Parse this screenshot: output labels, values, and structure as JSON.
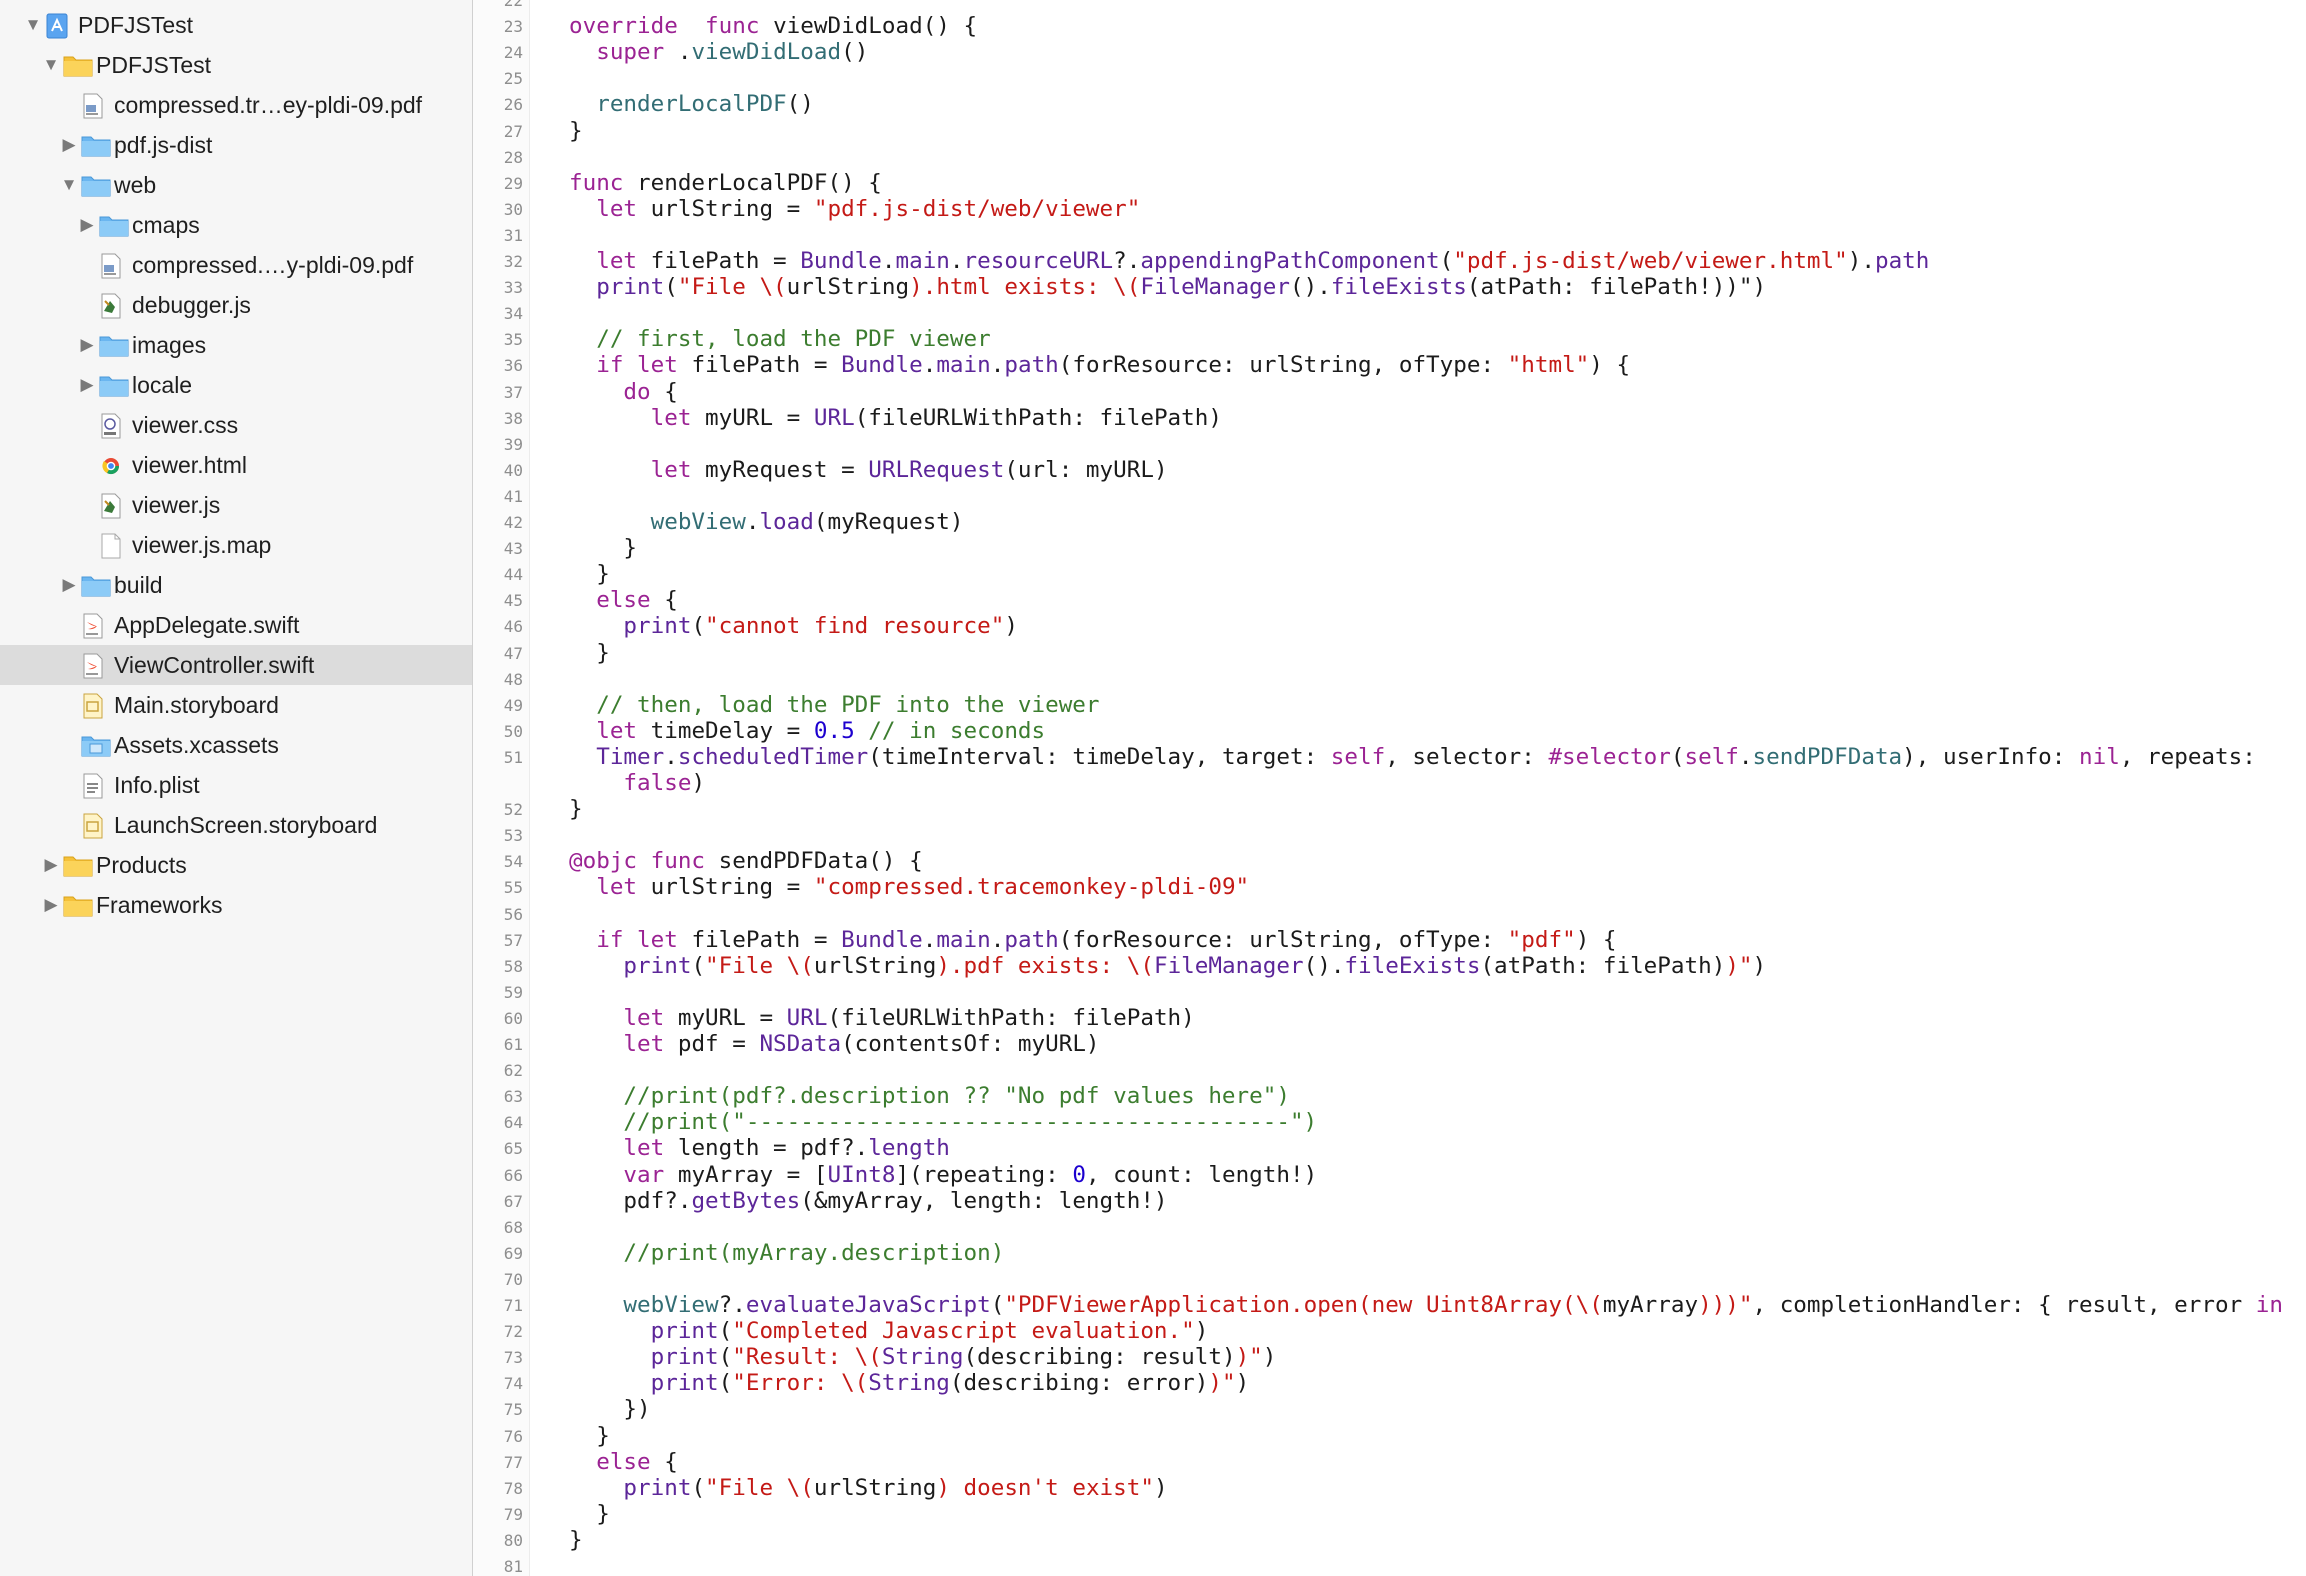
{
  "navigator": {
    "items": [
      {
        "id": "project",
        "label": "PDFJSTest",
        "depth": 0,
        "type": "project",
        "disclosure": "open"
      },
      {
        "id": "group-pdfjstest",
        "label": "PDFJSTest",
        "depth": 1,
        "type": "folder-yellow",
        "disclosure": "open"
      },
      {
        "id": "file-compressed-pdf",
        "label": "compressed.tr…ey-pldi-09.pdf",
        "depth": 2,
        "type": "pdf",
        "disclosure": "none"
      },
      {
        "id": "folder-pdfjs-dist",
        "label": "pdf.js-dist",
        "depth": 2,
        "type": "folder-blue",
        "disclosure": "closed"
      },
      {
        "id": "folder-web",
        "label": "web",
        "depth": 2,
        "type": "folder-blue",
        "disclosure": "open"
      },
      {
        "id": "folder-cmaps",
        "label": "cmaps",
        "depth": 3,
        "type": "folder-blue",
        "disclosure": "closed"
      },
      {
        "id": "file-web-compressed-pdf",
        "label": "compressed.…y-pldi-09.pdf",
        "depth": 3,
        "type": "pdf",
        "disclosure": "none"
      },
      {
        "id": "file-debugger-js",
        "label": "debugger.js",
        "depth": 3,
        "type": "js",
        "disclosure": "none"
      },
      {
        "id": "folder-images",
        "label": "images",
        "depth": 3,
        "type": "folder-blue",
        "disclosure": "closed"
      },
      {
        "id": "folder-locale",
        "label": "locale",
        "depth": 3,
        "type": "folder-blue",
        "disclosure": "closed"
      },
      {
        "id": "file-viewer-css",
        "label": "viewer.css",
        "depth": 3,
        "type": "css",
        "disclosure": "none"
      },
      {
        "id": "file-viewer-html",
        "label": "viewer.html",
        "depth": 3,
        "type": "html",
        "disclosure": "none"
      },
      {
        "id": "file-viewer-js",
        "label": "viewer.js",
        "depth": 3,
        "type": "js",
        "disclosure": "none"
      },
      {
        "id": "file-viewer-js-map",
        "label": "viewer.js.map",
        "depth": 3,
        "type": "blank",
        "disclosure": "none"
      },
      {
        "id": "folder-build",
        "label": "build",
        "depth": 2,
        "type": "folder-blue",
        "disclosure": "closed"
      },
      {
        "id": "file-appdelegate",
        "label": "AppDelegate.swift",
        "depth": 2,
        "type": "swift",
        "disclosure": "none"
      },
      {
        "id": "file-viewcontroller",
        "label": "ViewController.swift",
        "depth": 2,
        "type": "swift",
        "disclosure": "none",
        "selected": true
      },
      {
        "id": "file-main-storyboard",
        "label": "Main.storyboard",
        "depth": 2,
        "type": "storyboard",
        "disclosure": "none"
      },
      {
        "id": "file-assets",
        "label": "Assets.xcassets",
        "depth": 2,
        "type": "assets",
        "disclosure": "none"
      },
      {
        "id": "file-info-plist",
        "label": "Info.plist",
        "depth": 2,
        "type": "plist",
        "disclosure": "none"
      },
      {
        "id": "file-launchscreen",
        "label": "LaunchScreen.storyboard",
        "depth": 2,
        "type": "storyboard",
        "disclosure": "none"
      },
      {
        "id": "group-products",
        "label": "Products",
        "depth": 1,
        "type": "folder-yellow",
        "disclosure": "closed"
      },
      {
        "id": "group-frameworks",
        "label": "Frameworks",
        "depth": 1,
        "type": "folder-yellow",
        "disclosure": "closed"
      }
    ]
  },
  "editor": {
    "first_line_number": 22,
    "line_numbers": [
      "22",
      "23",
      "24",
      "25",
      "26",
      "27",
      "28",
      "29",
      "30",
      "31",
      "32",
      "33",
      "34",
      "35",
      "36",
      "37",
      "38",
      "39",
      "40",
      "41",
      "42",
      "43",
      "44",
      "45",
      "46",
      "47",
      "48",
      "49",
      "50",
      "51",
      "",
      "52",
      "53",
      "54",
      "55",
      "56",
      "57",
      "58",
      "59",
      "60",
      "61",
      "62",
      "63",
      "64",
      "65",
      "66",
      "67",
      "68",
      "69",
      "70",
      "71",
      "72",
      "73",
      "74",
      "75",
      "76",
      "77",
      "78",
      "79",
      "80",
      "81"
    ],
    "lines": [
      [],
      [
        [
          "k",
          "override"
        ],
        [
          "",
          "  "
        ],
        [
          "k",
          "func"
        ],
        [
          "",
          " viewDidLoad() {"
        ]
      ],
      [
        [
          "",
          "  "
        ],
        [
          "k",
          "super"
        ],
        [
          "",
          " ."
        ],
        [
          "m",
          "viewDidLoad"
        ],
        [
          "",
          "()"
        ]
      ],
      [],
      [
        [
          "",
          "  "
        ],
        [
          "m",
          "renderLocalPDF"
        ],
        [
          "",
          "()"
        ]
      ],
      [
        [
          "",
          "}"
        ]
      ],
      [],
      [
        [
          "k",
          "func"
        ],
        [
          "",
          " renderLocalPDF() {"
        ]
      ],
      [
        [
          "",
          "  "
        ],
        [
          "k",
          "let"
        ],
        [
          "",
          " urlString = "
        ],
        [
          "s",
          "\"pdf.js-dist/web/viewer\""
        ]
      ],
      [],
      [
        [
          "",
          "  "
        ],
        [
          "k",
          "let"
        ],
        [
          "",
          " filePath = "
        ],
        [
          "t",
          "Bundle"
        ],
        [
          "",
          "."
        ],
        [
          "t",
          "main"
        ],
        [
          "",
          "."
        ],
        [
          "t",
          "resourceURL"
        ],
        [
          "",
          "?."
        ],
        [
          "t",
          "appendingPathComponent"
        ],
        [
          "",
          "("
        ],
        [
          "s",
          "\"pdf.js-dist/web/viewer.html\""
        ],
        [
          "",
          ")."
        ],
        [
          "t",
          "path"
        ]
      ],
      [
        [
          "",
          "  "
        ],
        [
          "t",
          "print"
        ],
        [
          "",
          "("
        ],
        [
          "s",
          "\"File \\("
        ],
        [
          "",
          "urlString"
        ],
        [
          "s",
          ").html exists: \\("
        ],
        [
          "t",
          "FileManager"
        ],
        [
          "",
          "()."
        ],
        [
          "t",
          "fileExists"
        ],
        [
          "",
          "(atPath: filePath!))\""
        ],
        [
          "",
          ")"
        ]
      ],
      [],
      [
        [
          "",
          "  "
        ],
        [
          "c",
          "// first, load the PDF viewer"
        ]
      ],
      [
        [
          "",
          "  "
        ],
        [
          "k",
          "if"
        ],
        [
          "",
          ""
        ],
        [
          "k",
          " let"
        ],
        [
          "",
          " filePath = "
        ],
        [
          "t",
          "Bundle"
        ],
        [
          "",
          "."
        ],
        [
          "t",
          "main"
        ],
        [
          "",
          "."
        ],
        [
          "t",
          "path"
        ],
        [
          "",
          "(forResource: urlString, ofType: "
        ],
        [
          "s",
          "\"html\""
        ],
        [
          "",
          ") {"
        ]
      ],
      [
        [
          "",
          "    "
        ],
        [
          "k",
          "do"
        ],
        [
          "",
          " {"
        ]
      ],
      [
        [
          "",
          "      "
        ],
        [
          "k",
          "let"
        ],
        [
          "",
          " myURL = "
        ],
        [
          "t",
          "URL"
        ],
        [
          "",
          "(fileURLWithPath: filePath)"
        ]
      ],
      [],
      [
        [
          "",
          "      "
        ],
        [
          "k",
          "let"
        ],
        [
          "",
          " myRequest = "
        ],
        [
          "t",
          "URLRequest"
        ],
        [
          "",
          "(url: myURL)"
        ]
      ],
      [],
      [
        [
          "",
          "      "
        ],
        [
          "m",
          "webView"
        ],
        [
          "",
          "."
        ],
        [
          "t",
          "load"
        ],
        [
          "",
          "(myRequest)"
        ]
      ],
      [
        [
          "",
          "    }"
        ]
      ],
      [
        [
          "",
          "  }"
        ]
      ],
      [
        [
          "",
          "  "
        ],
        [
          "k",
          "else"
        ],
        [
          "",
          " {"
        ]
      ],
      [
        [
          "",
          "    "
        ],
        [
          "t",
          "print"
        ],
        [
          "",
          "("
        ],
        [
          "s",
          "\"cannot find resource\""
        ],
        [
          "",
          ")"
        ]
      ],
      [
        [
          "",
          "  }"
        ]
      ],
      [],
      [
        [
          "",
          "  "
        ],
        [
          "c",
          "// then, load the PDF into the viewer"
        ]
      ],
      [
        [
          "",
          "  "
        ],
        [
          "k",
          "let"
        ],
        [
          "",
          " timeDelay = "
        ],
        [
          "n",
          "0.5"
        ],
        [
          "",
          " "
        ],
        [
          "c",
          "// in seconds"
        ]
      ],
      [
        [
          "",
          "  "
        ],
        [
          "t",
          "Timer"
        ],
        [
          "",
          "."
        ],
        [
          "t",
          "scheduledTimer"
        ],
        [
          "",
          "(timeInterval: timeDelay, target: "
        ],
        [
          "k",
          "self"
        ],
        [
          "",
          ", selector: "
        ],
        [
          "k",
          "#selector"
        ],
        [
          "",
          "("
        ],
        [
          "k",
          "self"
        ],
        [
          "",
          "."
        ],
        [
          "m",
          "sendPDFData"
        ],
        [
          "",
          "), userInfo: "
        ],
        [
          "k",
          "nil"
        ],
        [
          "",
          ", repeats:"
        ]
      ],
      [
        [
          "",
          "    "
        ],
        [
          "k",
          "false"
        ],
        [
          "",
          ")"
        ]
      ],
      [
        [
          "",
          "}"
        ]
      ],
      [],
      [
        [
          "k",
          "@objc"
        ],
        [
          "",
          " "
        ],
        [
          "k",
          "func"
        ],
        [
          "",
          " sendPDFData() {"
        ]
      ],
      [
        [
          "",
          "  "
        ],
        [
          "k",
          "let"
        ],
        [
          "",
          " urlString = "
        ],
        [
          "s",
          "\"compressed.tracemonkey-pldi-09\""
        ]
      ],
      [],
      [
        [
          "",
          "  "
        ],
        [
          "k",
          "if"
        ],
        [
          "",
          " "
        ],
        [
          "k",
          "let"
        ],
        [
          "",
          " filePath = "
        ],
        [
          "t",
          "Bundle"
        ],
        [
          "",
          "."
        ],
        [
          "t",
          "main"
        ],
        [
          "",
          "."
        ],
        [
          "t",
          "path"
        ],
        [
          "",
          "(forResource: urlString, ofType: "
        ],
        [
          "s",
          "\"pdf\""
        ],
        [
          "",
          ") {"
        ]
      ],
      [
        [
          "",
          "    "
        ],
        [
          "t",
          "print"
        ],
        [
          "",
          "("
        ],
        [
          "s",
          "\"File \\("
        ],
        [
          "",
          "urlString"
        ],
        [
          "s",
          ").pdf exists: \\("
        ],
        [
          "t",
          "FileManager"
        ],
        [
          "",
          "()."
        ],
        [
          "t",
          "fileExists"
        ],
        [
          "",
          "(atPath: filePath)"
        ],
        [
          "s",
          ")\""
        ],
        [
          "",
          ")"
        ]
      ],
      [],
      [
        [
          "",
          "    "
        ],
        [
          "k",
          "let"
        ],
        [
          "",
          " myURL = "
        ],
        [
          "t",
          "URL"
        ],
        [
          "",
          "(fileURLWithPath: filePath)"
        ]
      ],
      [
        [
          "",
          "    "
        ],
        [
          "k",
          "let"
        ],
        [
          "",
          " pdf = "
        ],
        [
          "t",
          "NSData"
        ],
        [
          "",
          "(contentsOf: myURL)"
        ]
      ],
      [],
      [
        [
          "",
          "    "
        ],
        [
          "c",
          "//print(pdf?.description ?? \"No pdf values here\")"
        ]
      ],
      [
        [
          "",
          "    "
        ],
        [
          "c",
          "//print(\"----------------------------------------\")"
        ]
      ],
      [
        [
          "",
          "    "
        ],
        [
          "k",
          "let"
        ],
        [
          "",
          " length = pdf?."
        ],
        [
          "t",
          "length"
        ]
      ],
      [
        [
          "",
          "    "
        ],
        [
          "k",
          "var"
        ],
        [
          "",
          " myArray = ["
        ],
        [
          "t",
          "UInt8"
        ],
        [
          "",
          "](repeating: "
        ],
        [
          "n",
          "0"
        ],
        [
          "",
          ", count: length!)"
        ]
      ],
      [
        [
          "",
          "    pdf?."
        ],
        [
          "t",
          "getBytes"
        ],
        [
          "",
          "(&myArray, length: length!)"
        ]
      ],
      [],
      [
        [
          "",
          "    "
        ],
        [
          "c",
          "//print(myArray.description)"
        ]
      ],
      [],
      [
        [
          "",
          "    "
        ],
        [
          "m",
          "webView"
        ],
        [
          "",
          "?."
        ],
        [
          "t",
          "evaluateJavaScript"
        ],
        [
          "",
          "("
        ],
        [
          "s",
          "\"PDFViewerApplication.open(new Uint8Array(\\("
        ],
        [
          "",
          "myArray"
        ],
        [
          "s",
          ")))\""
        ],
        [
          "",
          ", completionHandler: { result, error "
        ],
        [
          "k",
          "in"
        ]
      ],
      [
        [
          "",
          "      "
        ],
        [
          "t",
          "print"
        ],
        [
          "",
          "("
        ],
        [
          "s",
          "\"Completed Javascript evaluation.\""
        ],
        [
          "",
          ")"
        ]
      ],
      [
        [
          "",
          "      "
        ],
        [
          "t",
          "print"
        ],
        [
          "",
          "("
        ],
        [
          "s",
          "\"Result: \\("
        ],
        [
          "t",
          "String"
        ],
        [
          "",
          "(describing: result)"
        ],
        [
          "s",
          ")\""
        ],
        [
          "",
          ")"
        ]
      ],
      [
        [
          "",
          "      "
        ],
        [
          "t",
          "print"
        ],
        [
          "",
          "("
        ],
        [
          "s",
          "\"Error: \\("
        ],
        [
          "t",
          "String"
        ],
        [
          "",
          "(describing: error)"
        ],
        [
          "s",
          ")\""
        ],
        [
          "",
          ")"
        ]
      ],
      [
        [
          "",
          "    })"
        ]
      ],
      [
        [
          "",
          "  }"
        ]
      ],
      [
        [
          "",
          "  "
        ],
        [
          "k",
          "else"
        ],
        [
          "",
          " {"
        ]
      ],
      [
        [
          "",
          "    "
        ],
        [
          "t",
          "print"
        ],
        [
          "",
          "("
        ],
        [
          "s",
          "\"File \\("
        ],
        [
          "",
          "urlString"
        ],
        [
          "s",
          ") doesn't exist\""
        ],
        [
          "",
          ")"
        ]
      ],
      [
        [
          "",
          "  }"
        ]
      ],
      [
        [
          "",
          "}"
        ]
      ],
      []
    ]
  },
  "colors": {
    "keyword": "#9b2393",
    "string": "#c41a16",
    "comment": "#3c7d2f",
    "type": "#5c2699",
    "member": "#326d74",
    "number": "#1c00cf",
    "selection": "#dcdcdc"
  }
}
